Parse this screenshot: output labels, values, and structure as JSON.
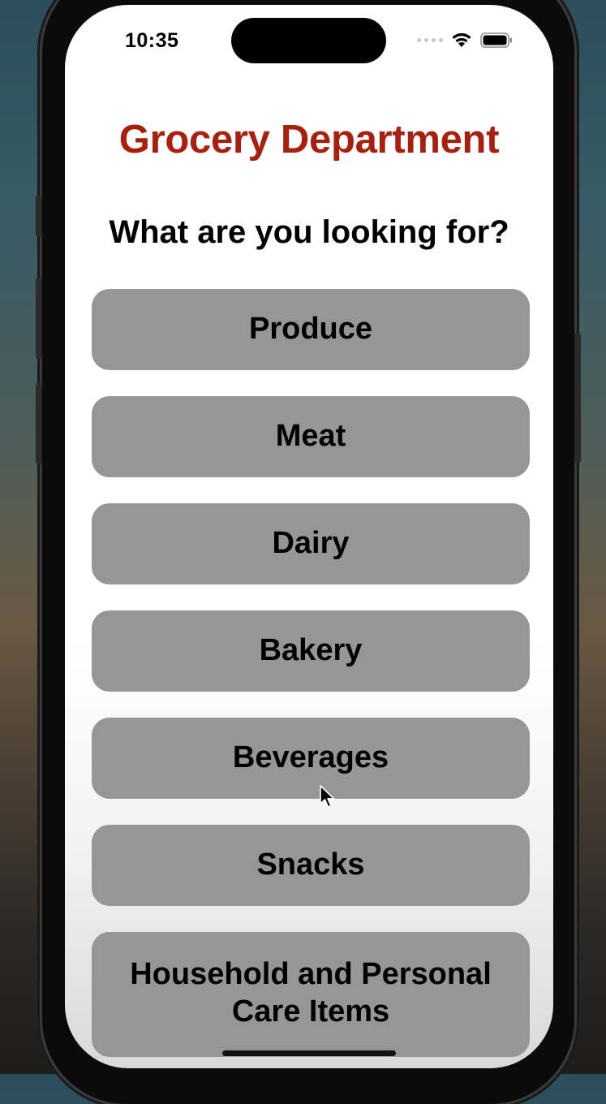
{
  "status_bar": {
    "time": "10:35"
  },
  "app": {
    "title": "Grocery Department",
    "subtitle": "What are you looking for?",
    "title_color": "#a8200d"
  },
  "categories": [
    {
      "label": "Produce"
    },
    {
      "label": "Meat"
    },
    {
      "label": "Dairy"
    },
    {
      "label": "Bakery"
    },
    {
      "label": "Beverages"
    },
    {
      "label": "Snacks"
    },
    {
      "label": "Household and Personal Care Items"
    }
  ],
  "colors": {
    "button_background": "#969696",
    "text": "#000000"
  },
  "icons": {
    "wifi": "wifi-icon",
    "battery": "battery-icon",
    "cursor": "cursor-icon"
  }
}
